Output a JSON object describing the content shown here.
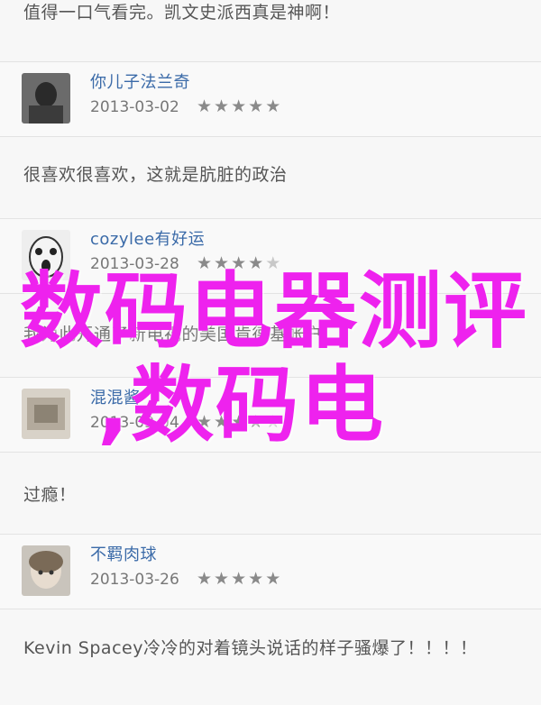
{
  "reviews": [
    {
      "text": "值得一口气看完。凯文史派西真是神啊！"
    },
    {
      "name": "你儿子法兰奇",
      "date": "2013-03-02",
      "rating": 5,
      "text": "很喜欢很喜欢，这就是肮脏的政治"
    },
    {
      "name": "cozylee有好运",
      "date": "2013-03-28",
      "rating": 4,
      "text": "我为此开通了新电视的美国肯德基帐户"
    },
    {
      "name": "混混酱",
      "date": "2013-03-04",
      "rating": 4,
      "text": "过瘾！"
    },
    {
      "name": "不羁肉球",
      "date": "2013-03-26",
      "rating": 5,
      "text": "Kevin Spacey冷冷的对着镜头说话的样子骚爆了！！！！"
    }
  ],
  "watermark": {
    "line1": "数码电器测评",
    "line2": ",数码电"
  },
  "colors": {
    "name": "#3a6aa8",
    "watermark": "#ee22ee"
  },
  "icons": {
    "star": "★"
  }
}
